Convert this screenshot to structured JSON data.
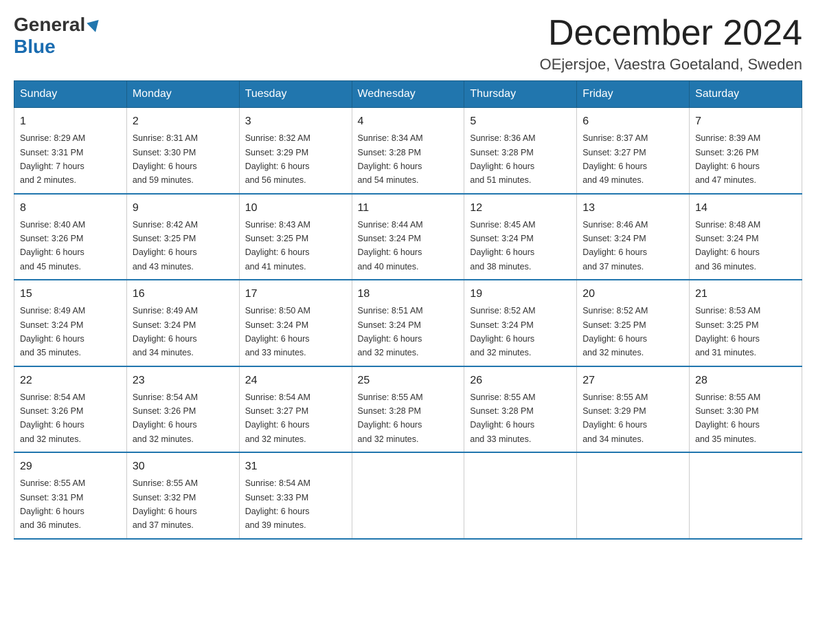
{
  "logo": {
    "general": "General",
    "blue": "Blue"
  },
  "title": "December 2024",
  "location": "OEjersjoe, Vaestra Goetaland, Sweden",
  "weekdays": [
    "Sunday",
    "Monday",
    "Tuesday",
    "Wednesday",
    "Thursday",
    "Friday",
    "Saturday"
  ],
  "weeks": [
    [
      {
        "day": "1",
        "sunrise": "8:29 AM",
        "sunset": "3:31 PM",
        "daylight": "7 hours and 2 minutes."
      },
      {
        "day": "2",
        "sunrise": "8:31 AM",
        "sunset": "3:30 PM",
        "daylight": "6 hours and 59 minutes."
      },
      {
        "day": "3",
        "sunrise": "8:32 AM",
        "sunset": "3:29 PM",
        "daylight": "6 hours and 56 minutes."
      },
      {
        "day": "4",
        "sunrise": "8:34 AM",
        "sunset": "3:28 PM",
        "daylight": "6 hours and 54 minutes."
      },
      {
        "day": "5",
        "sunrise": "8:36 AM",
        "sunset": "3:28 PM",
        "daylight": "6 hours and 51 minutes."
      },
      {
        "day": "6",
        "sunrise": "8:37 AM",
        "sunset": "3:27 PM",
        "daylight": "6 hours and 49 minutes."
      },
      {
        "day": "7",
        "sunrise": "8:39 AM",
        "sunset": "3:26 PM",
        "daylight": "6 hours and 47 minutes."
      }
    ],
    [
      {
        "day": "8",
        "sunrise": "8:40 AM",
        "sunset": "3:26 PM",
        "daylight": "6 hours and 45 minutes."
      },
      {
        "day": "9",
        "sunrise": "8:42 AM",
        "sunset": "3:25 PM",
        "daylight": "6 hours and 43 minutes."
      },
      {
        "day": "10",
        "sunrise": "8:43 AM",
        "sunset": "3:25 PM",
        "daylight": "6 hours and 41 minutes."
      },
      {
        "day": "11",
        "sunrise": "8:44 AM",
        "sunset": "3:24 PM",
        "daylight": "6 hours and 40 minutes."
      },
      {
        "day": "12",
        "sunrise": "8:45 AM",
        "sunset": "3:24 PM",
        "daylight": "6 hours and 38 minutes."
      },
      {
        "day": "13",
        "sunrise": "8:46 AM",
        "sunset": "3:24 PM",
        "daylight": "6 hours and 37 minutes."
      },
      {
        "day": "14",
        "sunrise": "8:48 AM",
        "sunset": "3:24 PM",
        "daylight": "6 hours and 36 minutes."
      }
    ],
    [
      {
        "day": "15",
        "sunrise": "8:49 AM",
        "sunset": "3:24 PM",
        "daylight": "6 hours and 35 minutes."
      },
      {
        "day": "16",
        "sunrise": "8:49 AM",
        "sunset": "3:24 PM",
        "daylight": "6 hours and 34 minutes."
      },
      {
        "day": "17",
        "sunrise": "8:50 AM",
        "sunset": "3:24 PM",
        "daylight": "6 hours and 33 minutes."
      },
      {
        "day": "18",
        "sunrise": "8:51 AM",
        "sunset": "3:24 PM",
        "daylight": "6 hours and 32 minutes."
      },
      {
        "day": "19",
        "sunrise": "8:52 AM",
        "sunset": "3:24 PM",
        "daylight": "6 hours and 32 minutes."
      },
      {
        "day": "20",
        "sunrise": "8:52 AM",
        "sunset": "3:25 PM",
        "daylight": "6 hours and 32 minutes."
      },
      {
        "day": "21",
        "sunrise": "8:53 AM",
        "sunset": "3:25 PM",
        "daylight": "6 hours and 31 minutes."
      }
    ],
    [
      {
        "day": "22",
        "sunrise": "8:54 AM",
        "sunset": "3:26 PM",
        "daylight": "6 hours and 32 minutes."
      },
      {
        "day": "23",
        "sunrise": "8:54 AM",
        "sunset": "3:26 PM",
        "daylight": "6 hours and 32 minutes."
      },
      {
        "day": "24",
        "sunrise": "8:54 AM",
        "sunset": "3:27 PM",
        "daylight": "6 hours and 32 minutes."
      },
      {
        "day": "25",
        "sunrise": "8:55 AM",
        "sunset": "3:28 PM",
        "daylight": "6 hours and 32 minutes."
      },
      {
        "day": "26",
        "sunrise": "8:55 AM",
        "sunset": "3:28 PM",
        "daylight": "6 hours and 33 minutes."
      },
      {
        "day": "27",
        "sunrise": "8:55 AM",
        "sunset": "3:29 PM",
        "daylight": "6 hours and 34 minutes."
      },
      {
        "day": "28",
        "sunrise": "8:55 AM",
        "sunset": "3:30 PM",
        "daylight": "6 hours and 35 minutes."
      }
    ],
    [
      {
        "day": "29",
        "sunrise": "8:55 AM",
        "sunset": "3:31 PM",
        "daylight": "6 hours and 36 minutes."
      },
      {
        "day": "30",
        "sunrise": "8:55 AM",
        "sunset": "3:32 PM",
        "daylight": "6 hours and 37 minutes."
      },
      {
        "day": "31",
        "sunrise": "8:54 AM",
        "sunset": "3:33 PM",
        "daylight": "6 hours and 39 minutes."
      },
      null,
      null,
      null,
      null
    ]
  ],
  "labels": {
    "sunrise": "Sunrise:",
    "sunset": "Sunset:",
    "daylight": "Daylight:"
  }
}
